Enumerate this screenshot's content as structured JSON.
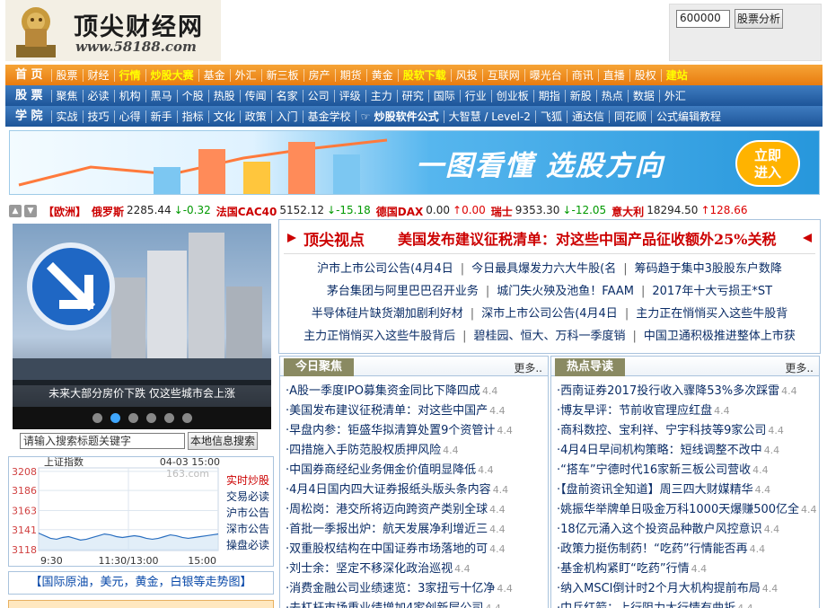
{
  "header": {
    "site_name": "顶尖财经网",
    "site_url": "www.58188.com",
    "stock_input_value": "600000",
    "stock_button": "股票分析"
  },
  "nav1": [
    {
      "label": "首 页",
      "style": "head"
    },
    {
      "label": "股票"
    },
    {
      "label": "财经"
    },
    {
      "label": "行情",
      "style": "y"
    },
    {
      "label": "炒股大赛",
      "style": "y"
    },
    {
      "label": "基金"
    },
    {
      "label": "外汇"
    },
    {
      "label": "新三板"
    },
    {
      "label": "房产"
    },
    {
      "label": "期货"
    },
    {
      "label": "黄金"
    },
    {
      "label": "股软下载",
      "style": "y"
    },
    {
      "label": "风投"
    },
    {
      "label": "互联网"
    },
    {
      "label": "曝光台"
    },
    {
      "label": "商讯"
    },
    {
      "label": "直播"
    },
    {
      "label": "股权"
    },
    {
      "label": "建站",
      "style": "y"
    }
  ],
  "nav2": [
    {
      "label": "股 票",
      "style": "head"
    },
    {
      "label": "聚焦"
    },
    {
      "label": "必读"
    },
    {
      "label": "机构"
    },
    {
      "label": "黑马"
    },
    {
      "label": "个股"
    },
    {
      "label": "热股"
    },
    {
      "label": "传闻"
    },
    {
      "label": "名家"
    },
    {
      "label": "公司"
    },
    {
      "label": "评级"
    },
    {
      "label": "主力"
    },
    {
      "label": "研究"
    },
    {
      "label": "国际"
    },
    {
      "label": "行业"
    },
    {
      "label": "创业板"
    },
    {
      "label": "期指"
    },
    {
      "label": "新股"
    },
    {
      "label": "热点"
    },
    {
      "label": "数据"
    },
    {
      "label": "外汇"
    }
  ],
  "nav3": [
    {
      "label": "学 院",
      "style": "head"
    },
    {
      "label": "实战"
    },
    {
      "label": "技巧"
    },
    {
      "label": "心得"
    },
    {
      "label": "新手"
    },
    {
      "label": "指标"
    },
    {
      "label": "文化"
    },
    {
      "label": "政策"
    },
    {
      "label": "入门"
    },
    {
      "label": "基金学校"
    },
    {
      "label": "☞ 炒股软件公式",
      "style": "bw"
    },
    {
      "label": "大智慧 / Level-2"
    },
    {
      "label": "飞狐"
    },
    {
      "label": "通达信"
    },
    {
      "label": "同花顺"
    },
    {
      "label": "公式编辑教程"
    }
  ],
  "banner": {
    "text": "一图看懂  选股方向",
    "button_line1": "立即",
    "button_line2": "进入"
  },
  "ticker": {
    "region": "【欧洲】",
    "items": [
      {
        "name": "俄罗斯",
        "value": "2285.44",
        "dir": "down",
        "change": "-0.32"
      },
      {
        "name": "法国CAC40",
        "value": "5152.12",
        "dir": "down",
        "change": "-15.18"
      },
      {
        "name": "德国DAX",
        "value": "0.00",
        "dir": "up",
        "change": "0.00"
      },
      {
        "name": "瑞士",
        "value": "9353.30",
        "dir": "down",
        "change": "-12.05"
      },
      {
        "name": "意大利",
        "value": "18294.50",
        "dir": "up",
        "change": "128.66"
      }
    ]
  },
  "slide": {
    "caption": "未来大部分房价下跌 仅这些城市会上涨",
    "dots": 6,
    "active_dot": 2
  },
  "search": {
    "placeholder": "请输入搜索标题关键字",
    "button": "本地信息搜索"
  },
  "index_chart": {
    "title": "上证指数",
    "date_time": "04-03 15:00",
    "watermark": "163.com",
    "yticks": [
      3208,
      3186,
      3163,
      3141,
      3118
    ],
    "xticks": [
      "9:30",
      "11:30/13:00",
      "15:00"
    ]
  },
  "chart_data": {
    "type": "line",
    "title": "上证指数",
    "x": [
      "9:30",
      "11:30/13:00",
      "15:00"
    ],
    "ylim": [
      3118,
      3208
    ],
    "series": [
      {
        "name": "上证指数",
        "values": [
          3137,
          3134,
          3131,
          3130,
          3132,
          3133,
          3131,
          3129,
          3130,
          3132,
          3134,
          3136,
          3135,
          3133,
          3132,
          3133,
          3134,
          3133,
          3131,
          3130,
          3131,
          3133,
          3135,
          3134,
          3132,
          3131,
          3132,
          3133,
          3134,
          3135,
          3136
        ]
      }
    ]
  },
  "index_links": [
    "实时炒股",
    "交易必读",
    "沪市公告",
    "深市公告",
    "操盘必读"
  ],
  "oil_bar": "【国际原油，美元，黄金，白银等走势图】",
  "viewpoint": {
    "label": "顶尖视点",
    "headline": "美国发布建议征税清单：对这些中国产品征收额外25%关税"
  },
  "headline_rows": [
    [
      "沪市上市公司公告(4月4日",
      "今日最具爆发力六大牛股(名",
      "筹码趋于集中3股股东户数降"
    ],
    [
      "茅台集团与阿里巴巴召开业务",
      "城门失火殃及池鱼！FAAM",
      "2017年十大亏损王*ST"
    ],
    [
      "半导体硅片缺货潮加剧利好材",
      "深市上市公司公告(4月4日",
      "主力正在悄悄买入这些牛股背"
    ],
    [
      "主力正悄悄买入这些牛股背后",
      "碧桂园、恒大、万科一季度销",
      "中国卫通积极推进整体上市获"
    ]
  ],
  "focus": {
    "title": "今日聚焦",
    "more": "更多..",
    "items": [
      {
        "t": "·A股一季度IPO募集资金同比下降四成",
        "d": "4.4"
      },
      {
        "t": "·美国发布建议征税清单：对这些中国产",
        "d": "4.4"
      },
      {
        "t": "·早盘内参：钜盛华拟清算处置9个资管计",
        "d": "4.4"
      },
      {
        "t": "·四措施入手防范股权质押风险",
        "d": "4.4"
      },
      {
        "t": "·中国券商经纪业务佣金价值明显降低",
        "d": "4.4"
      },
      {
        "t": "·4月4日国内四大证券报纸头版头条内容",
        "d": "4.4"
      },
      {
        "t": "·周松岗：港交所将迈向跨资产类别全球",
        "d": "4.4"
      },
      {
        "t": "·首批一季报出炉：航天发展净利增近三",
        "d": "4.4"
      },
      {
        "t": "·双重股权结构在中国证券市场落地的可",
        "d": "4.4"
      },
      {
        "t": "·刘士余：坚定不移深化政治巡视",
        "d": "4.4"
      },
      {
        "t": "·消费金融公司业绩速览：3家扭亏十亿净",
        "d": "4.4"
      },
      {
        "t": "·去杠杆市场重业绩增加4家创新层公司",
        "d": "4.4"
      }
    ]
  },
  "hot": {
    "title": "热点导读",
    "more": "更多..",
    "items": [
      {
        "t": "·西南证券2017投行收入骤降53%多次踩雷",
        "d": "4.4"
      },
      {
        "t": "·博友早评：节前收官理应红盘",
        "d": "4.4"
      },
      {
        "t": "·商科数控、宝利祥、宁宇科技等9家公司",
        "d": "4.4"
      },
      {
        "t": "·4月4日早间机构策略：短线调整不改中",
        "d": "4.4"
      },
      {
        "t": "·“搭车”宁德时代16家新三板公司营收",
        "d": "4.4"
      },
      {
        "t": "·【盘前资讯全知道】周三四大财媒精华",
        "d": "4.4"
      },
      {
        "t": "·姚振华举牌单日吸金万科1000天爆赚500亿全",
        "d": "4.4"
      },
      {
        "t": "·18亿元涌入这个投资品种散户风控意识",
        "d": "4.4"
      },
      {
        "t": "·政策力挺伤制药！“吃药”行情能否再",
        "d": "4.4"
      },
      {
        "t": "·基金机构紧盯“吃药”行情",
        "d": "4.4"
      },
      {
        "t": "·纳入MSCI倒计时2个月大机构提前布局",
        "d": "4.4"
      },
      {
        "t": "·中兵红箭：上行阻力大行情有曲折",
        "d": "4.4"
      }
    ]
  },
  "colors": {
    "nav_orange": "#e87c10",
    "nav_blue": "#1d5599",
    "accent_red": "#cc0000",
    "link_blue": "#0a2c66",
    "highlight_yellow": "#ffff00"
  }
}
